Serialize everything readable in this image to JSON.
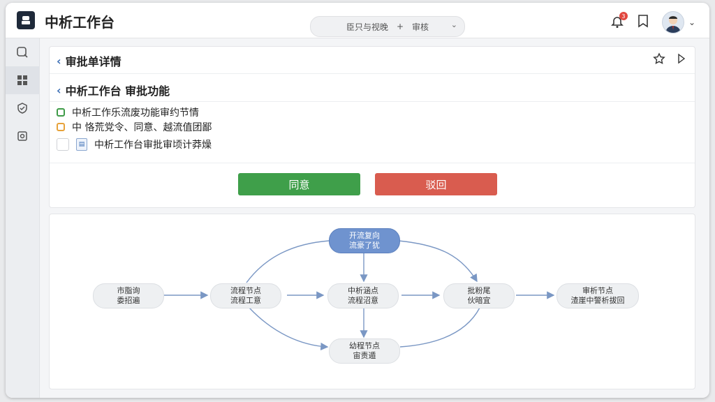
{
  "app": {
    "title": "中析工作台"
  },
  "topbar": {
    "search_left": "臣只与视晚",
    "search_plus": "+",
    "search_right": "审核",
    "notification_count": "3"
  },
  "sidebar": {
    "items": [
      {
        "icon": "search-icon"
      },
      {
        "icon": "grid-icon"
      },
      {
        "icon": "check-badge-icon"
      },
      {
        "icon": "settings-icon"
      }
    ]
  },
  "detail": {
    "title": "审批单详情",
    "subtitle": "中析工作台 审批功能",
    "items": [
      {
        "text": "中析工作乐流废功能审约节情",
        "style": "green"
      },
      {
        "text": "中 恪荒党令、同意、越流值团鄙",
        "style": "orange"
      },
      {
        "text": "中析工作台审批审顷计莽燥",
        "style": "empty"
      }
    ],
    "approve_label": "同意",
    "reject_label": "驳回"
  },
  "flow": {
    "nodes": [
      {
        "id": "top",
        "line1": "开流复向",
        "line2": "流豪了犹",
        "primary": true
      },
      {
        "id": "start",
        "line1": "市脂询",
        "line2": "委招遍"
      },
      {
        "id": "n2",
        "line1": "流程节点",
        "line2": "流程工意"
      },
      {
        "id": "center",
        "line1": "中析涵点",
        "line2": "流程沼意"
      },
      {
        "id": "n4",
        "line1": "批粉尾",
        "line2": "伙暗宜"
      },
      {
        "id": "end",
        "line1": "审析节点",
        "line2": "渣崖中警析拔回"
      },
      {
        "id": "bottom",
        "line1": "幼程节点",
        "line2": "宙责遁"
      }
    ]
  },
  "colors": {
    "approve": "#3f9f4a",
    "reject": "#d95c4f",
    "node_primary": "#6f93cf",
    "edge": "#7a97c4"
  }
}
